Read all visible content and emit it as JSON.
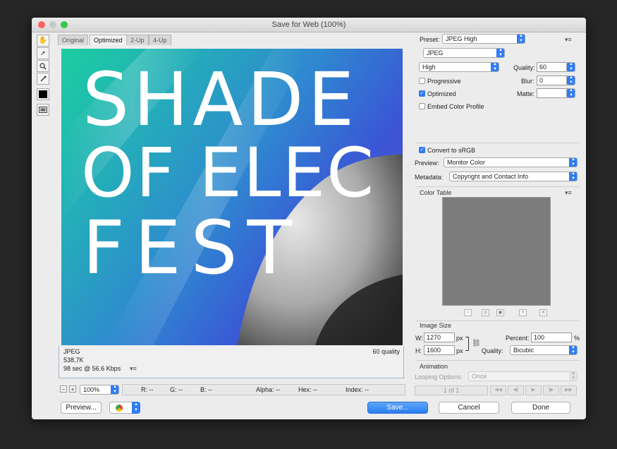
{
  "window": {
    "title": "Save for Web (100%)"
  },
  "colors": {
    "accent": "#2f7cf6",
    "close": "#fc605b",
    "minimize": "#fdbc40",
    "zoom": "#34c84a"
  },
  "toolbar": {
    "tools": [
      "hand-icon",
      "slice-select-icon",
      "zoom-icon",
      "eyedropper-icon",
      "eyedropper-color-icon",
      "toggle-slices-icon"
    ]
  },
  "tabs": [
    "Original",
    "Optimized",
    "2-Up",
    "4-Up"
  ],
  "artwork": {
    "line1": "SHADE",
    "line2": "OF ELEC",
    "line3": "FEST"
  },
  "image_info": {
    "format": "JPEG",
    "size": "538,7K",
    "download": "98 sec @ 56.6 Kbps",
    "quality": "60 quality"
  },
  "statusbar": {
    "zoom": "100%",
    "r": "R: --",
    "g": "G: --",
    "b": "B: --",
    "alpha": "Alpha: --",
    "hex": "Hex: --",
    "index": "Index: --"
  },
  "settings": {
    "preset_label": "Preset:",
    "preset_value": "JPEG High",
    "format_value": "JPEG",
    "compression_value": "High",
    "quality_label": "Quality:",
    "quality_value": "60",
    "blur_label": "Blur:",
    "blur_value": "0",
    "matte_label": "Matte:",
    "progressive_label": "Progressive",
    "progressive_checked": false,
    "optimized_label": "Optimized",
    "optimized_checked": true,
    "embed_label": "Embed Color Profile",
    "embed_checked": false,
    "srgb_label": "Convert to sRGB",
    "srgb_checked": true,
    "preview_label": "Preview:",
    "preview_value": "Monitor Color",
    "metadata_label": "Metadata:",
    "metadata_value": "Copyright and Contact Info"
  },
  "color_table": {
    "title": "Color Table"
  },
  "image_size": {
    "title": "Image Size",
    "w_label": "W:",
    "w_value": "1270",
    "h_label": "H:",
    "h_value": "1600",
    "unit": "px",
    "percent_label": "Percent:",
    "percent_value": "100",
    "percent_unit": "%",
    "quality_label": "Quality:",
    "quality_value": "Bicubic"
  },
  "animation": {
    "title": "Animation",
    "looping_label": "Looping Options:",
    "looping_value": "Once",
    "frame_counter": "1 of 1"
  },
  "buttons": {
    "preview": "Preview...",
    "save": "Save...",
    "cancel": "Cancel",
    "done": "Done"
  }
}
